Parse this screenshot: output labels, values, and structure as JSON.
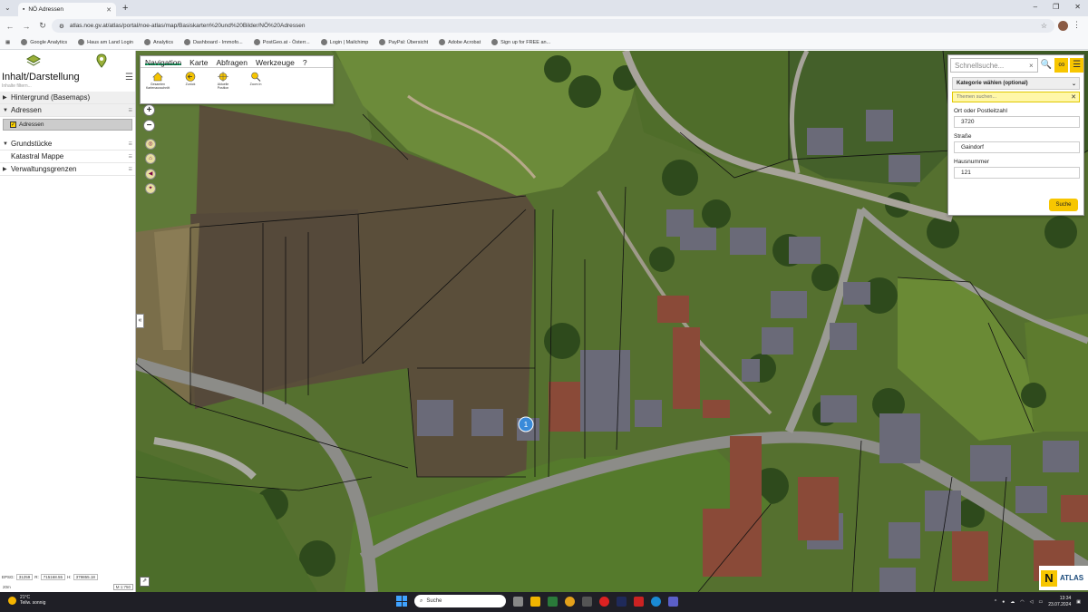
{
  "browser": {
    "tab_title": "NÖ Adressen",
    "url": "atlas.noe.gv.at/atlas/portal/noe-atlas/map/Basiskarten%20und%20Bilder/NÖ%20Adressen",
    "bookmarks": [
      "Google Analytics",
      "Haus am Land Login",
      "Analytics",
      "Dashboard - Immofo...",
      "PostGeo.at - Österr...",
      "Login | Mailchimp",
      "PayPal: Übersicht",
      "Adobe Acrobat",
      "Sign up for FREE an..."
    ]
  },
  "left_panel": {
    "title": "Inhalt/Darstellung",
    "filter_placeholder": "Inhalte filtern...",
    "layers": [
      {
        "label": "Hintergrund (Basemaps)"
      },
      {
        "label": "Adressen"
      },
      {
        "label": "Grundstücke"
      },
      {
        "label": "Katastral Mappe"
      },
      {
        "label": "Verwaltungsgrenzen"
      }
    ],
    "sublayer": "Adressen",
    "coords": {
      "epsg_label": "EPSG:",
      "epsg": "31259",
      "r_label": "R:",
      "r": "715168.55",
      "h_label": "H:",
      "h": "379855.18"
    },
    "scale_left": "20m",
    "scale": "M 1:750"
  },
  "toolbar": {
    "tabs": [
      "Navigation",
      "Karte",
      "Abfragen",
      "Werkzeuge",
      "?"
    ],
    "tools": [
      "Gesamten Kartenausschnitt",
      "Zurück",
      "Aktuelle Position",
      "Zoom In"
    ]
  },
  "search": {
    "quick_placeholder": "Schnellsuche...",
    "category": "Kategorie wählen (optional)",
    "theme_placeholder": "Themen suchen...",
    "labels": {
      "place": "Ort oder Postleitzahl",
      "street": "Straße",
      "house": "Hausnummer"
    },
    "values": {
      "place": "3720",
      "street": "Gaindorf",
      "house": "121"
    },
    "submit": "Suche"
  },
  "atlas_logo": "ATLAS",
  "marker_number": "1",
  "taskbar": {
    "temp": "21°C",
    "weather": "Teilw. sonnig",
    "search": "Suche",
    "time": "13:34",
    "date": "23.07.2024"
  }
}
